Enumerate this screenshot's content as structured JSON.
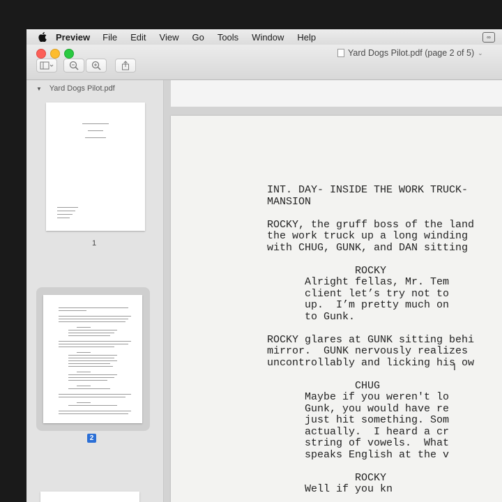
{
  "menubar": {
    "app_name": "Preview",
    "items": [
      "File",
      "Edit",
      "View",
      "Go",
      "Tools",
      "Window",
      "Help"
    ]
  },
  "window": {
    "title": "Yard Dogs Pilot.pdf (page 2 of 5)"
  },
  "sidebar": {
    "file_name": "Yard Dogs Pilot.pdf",
    "pages": [
      {
        "label": "1",
        "selected": false
      },
      {
        "label": "2",
        "selected": true
      }
    ]
  },
  "document": {
    "lines": [
      "INT. DAY- INSIDE THE WORK TRUCK-",
      "MANSION",
      "",
      "ROCKY, the gruff boss of the land",
      "the work truck up a long winding",
      "with CHUG, GUNK, and DAN sitting",
      "",
      "              ROCKY",
      "      Alright fellas, Mr. Tem",
      "      client let’s try not to",
      "      up.  I’m pretty much on",
      "      to Gunk.",
      "",
      "ROCKY glares at GUNK sitting behi",
      "mirror.  GUNK nervously realizes",
      "uncontrollably and licking his ow",
      "",
      "              CHUG",
      "      Maybe if you weren't lo",
      "      Gunk, you would have re",
      "      just hit something. Som",
      "      actually.  I heard a cr",
      "      string of vowels.  What",
      "      speaks English at the v",
      "",
      "              ROCKY",
      "      Well if you kn"
    ]
  }
}
